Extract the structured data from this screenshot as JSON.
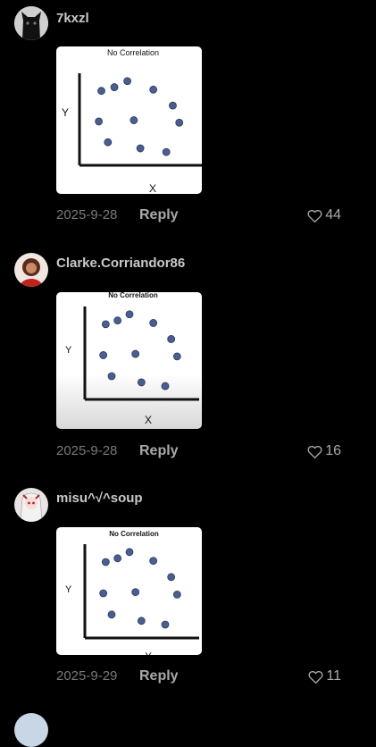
{
  "comments": [
    {
      "username": "7kxzl",
      "date": "2025-9-28",
      "reply_label": "Reply",
      "likes": "44",
      "chart_data": {
        "type": "scatter",
        "title": "No Correlation",
        "xlabel": "X",
        "ylabel": "Y",
        "grid": false,
        "marker_color": "#4a5f8f",
        "points": [
          [
            1,
            7
          ],
          [
            2,
            7.3
          ],
          [
            3,
            7.8
          ],
          [
            5,
            7.1
          ],
          [
            6.5,
            5.8
          ],
          [
            0.8,
            4.5
          ],
          [
            3.5,
            4.6
          ],
          [
            7,
            4.4
          ],
          [
            1.5,
            2.8
          ],
          [
            4,
            2.3
          ],
          [
            6,
            2
          ]
        ]
      }
    },
    {
      "username": "Clarke.Corriandor86",
      "date": "2025-9-28",
      "reply_label": "Reply",
      "likes": "16",
      "chart_data": {
        "type": "scatter",
        "title": "No Correlation",
        "xlabel": "X",
        "ylabel": "Y",
        "grid": false,
        "marker_color": "#4a5f8f",
        "points": [
          [
            1,
            7
          ],
          [
            2,
            7.3
          ],
          [
            3,
            7.8
          ],
          [
            5,
            7.1
          ],
          [
            6.5,
            5.8
          ],
          [
            0.8,
            4.5
          ],
          [
            3.5,
            4.6
          ],
          [
            7,
            4.4
          ],
          [
            1.5,
            2.8
          ],
          [
            4,
            2.3
          ],
          [
            6,
            2
          ]
        ]
      }
    },
    {
      "username": "misu^√^soup",
      "date": "2025-9-29",
      "reply_label": "Reply",
      "likes": "11",
      "chart_data": {
        "type": "scatter",
        "title": "No Correlation",
        "xlabel": "X",
        "ylabel": "Y",
        "grid": false,
        "marker_color": "#4a5f8f",
        "points": [
          [
            1,
            7
          ],
          [
            2,
            7.3
          ],
          [
            3,
            7.8
          ],
          [
            5,
            7.1
          ],
          [
            6.5,
            5.8
          ],
          [
            0.8,
            4.5
          ],
          [
            3.5,
            4.6
          ],
          [
            7,
            4.4
          ],
          [
            1.5,
            2.8
          ],
          [
            4,
            2.3
          ],
          [
            6,
            2
          ]
        ]
      }
    }
  ],
  "icons": {
    "like": "heart-outline-icon"
  }
}
